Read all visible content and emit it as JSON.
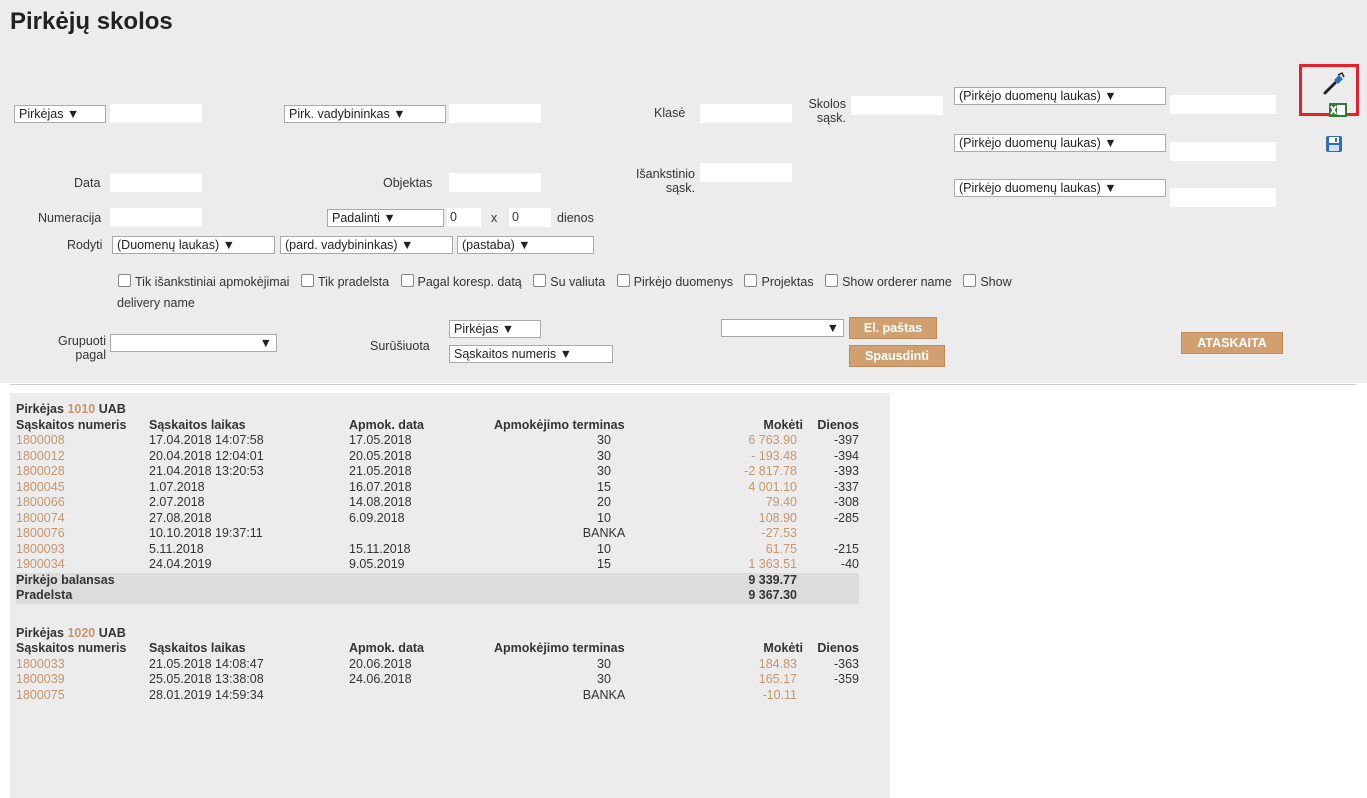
{
  "page_title": "Pirkėjų skolos",
  "filters": {
    "customer_select": "Pirkėjas ▼",
    "manager_select": "Pirk. vadybininkas ▼",
    "class_label": "Klasė",
    "debt_invoice_label_1": "Skolos",
    "debt_invoice_label_2": "sąsk.",
    "customer_field_1": "(Pirkėjo duomenų laukas) ▼",
    "customer_field_2": "(Pirkėjo duomenų laukas) ▼",
    "customer_field_3": "(Pirkėjo duomenų laukas) ▼",
    "date_label": "Data",
    "object_label": "Objektas",
    "prepay_label_1": "Išankstinio",
    "prepay_label_2": "sąsk.",
    "numbering_label": "Numeracija",
    "split_select": "Padalinti ▼",
    "split_value_a": "0",
    "split_x": "x",
    "split_value_b": "0",
    "days_label": "dienos",
    "show_label": "Rodyti",
    "show_field_select": "(Duomenų laukas) ▼",
    "show_manager_select": "(pard. vadybininkas) ▼",
    "show_note_select": "(pastaba) ▼",
    "checkboxes": [
      "Tik išankstiniai apmokėjimai",
      "Tik pradelsta",
      "Pagal koresp. datą",
      "Su valiuta",
      "Pirkėjo duomenys",
      "Projektas",
      "Show orderer name",
      "Show"
    ],
    "checkbox_wrap": "delivery name",
    "group_label_1": "Grupuoti",
    "group_label_2": "pagal",
    "group_select": "▼",
    "sorted_label": "Surūšiuota",
    "sort_select_1": "Pirkėjas ▼",
    "sort_select_2": "Sąskaitos numeris ▼",
    "email_select": "▼",
    "email_button": "El. paštas",
    "print_button": "Spausdinti",
    "report_button": "ATASKAITA"
  },
  "columns": [
    "Sąskaitos numeris",
    "Sąskaitos laikas",
    "Apmok. data",
    "Apmokėjimo terminas",
    "Mokėti",
    "Dienos"
  ],
  "groups": [
    {
      "prefix": "Pirkėjas",
      "code": "1010",
      "name": "UAB",
      "rows": [
        {
          "invoice": "1800008",
          "time": "17.04.2018 14:07:58",
          "due": "17.05.2018",
          "term": "30",
          "pay": "6 763.90",
          "days": "-397"
        },
        {
          "invoice": "1800012",
          "time": "20.04.2018 12:04:01",
          "due": "20.05.2018",
          "term": "30",
          "pay": "- 193.48",
          "days": "-394"
        },
        {
          "invoice": "1800028",
          "time": "21.04.2018 13:20:53",
          "due": "21.05.2018",
          "term": "30",
          "pay": "-2 817.78",
          "days": "-393"
        },
        {
          "invoice": "1800045",
          "time": "1.07.2018",
          "due": "16.07.2018",
          "term": "15",
          "pay": "4 001.10",
          "days": "-337"
        },
        {
          "invoice": "1800066",
          "time": "2.07.2018",
          "due": "14.08.2018",
          "term": "20",
          "pay": "79.40",
          "days": "-308"
        },
        {
          "invoice": "1800074",
          "time": "27.08.2018",
          "due": "6.09.2018",
          "term": "10",
          "pay": "108.90",
          "days": "-285"
        },
        {
          "invoice": "1800076",
          "time": "10.10.2018 19:37:11",
          "due": "",
          "term": "BANKA",
          "pay": "-27.53",
          "days": ""
        },
        {
          "invoice": "1800093",
          "time": "5.11.2018",
          "due": "15.11.2018",
          "term": "10",
          "pay": "61.75",
          "days": "-215"
        },
        {
          "invoice": "1900034",
          "time": "24.04.2019",
          "due": "9.05.2019",
          "term": "15",
          "pay": "1 363.51",
          "days": "-40"
        }
      ],
      "balance_label": "Pirkėjo balansas",
      "balance_value": "9 339.77",
      "overdue_label": "Pradelsta",
      "overdue_value": "9 367.30"
    },
    {
      "prefix": "Pirkėjas",
      "code": "1020",
      "name": "UAB",
      "rows": [
        {
          "invoice": "1800033",
          "time": "21.05.2018 14:08:47",
          "due": "20.06.2018",
          "term": "30",
          "pay": "184.83",
          "days": "-363"
        },
        {
          "invoice": "1800039",
          "time": "25.05.2018 13:38:08",
          "due": "24.06.2018",
          "term": "30",
          "pay": "165.17",
          "days": "-359"
        },
        {
          "invoice": "1800075",
          "time": "28.01.2019 14:59:34",
          "due": "",
          "term": "BANKA",
          "pay": "-10.11",
          "days": ""
        }
      ]
    }
  ],
  "colors": {
    "link": "#c8966a",
    "button": "#d0a070",
    "highlight": "#e8202a",
    "panel": "#ececec"
  },
  "icons": [
    "settings-wrench-icon",
    "excel-export-icon",
    "save-disk-icon"
  ]
}
